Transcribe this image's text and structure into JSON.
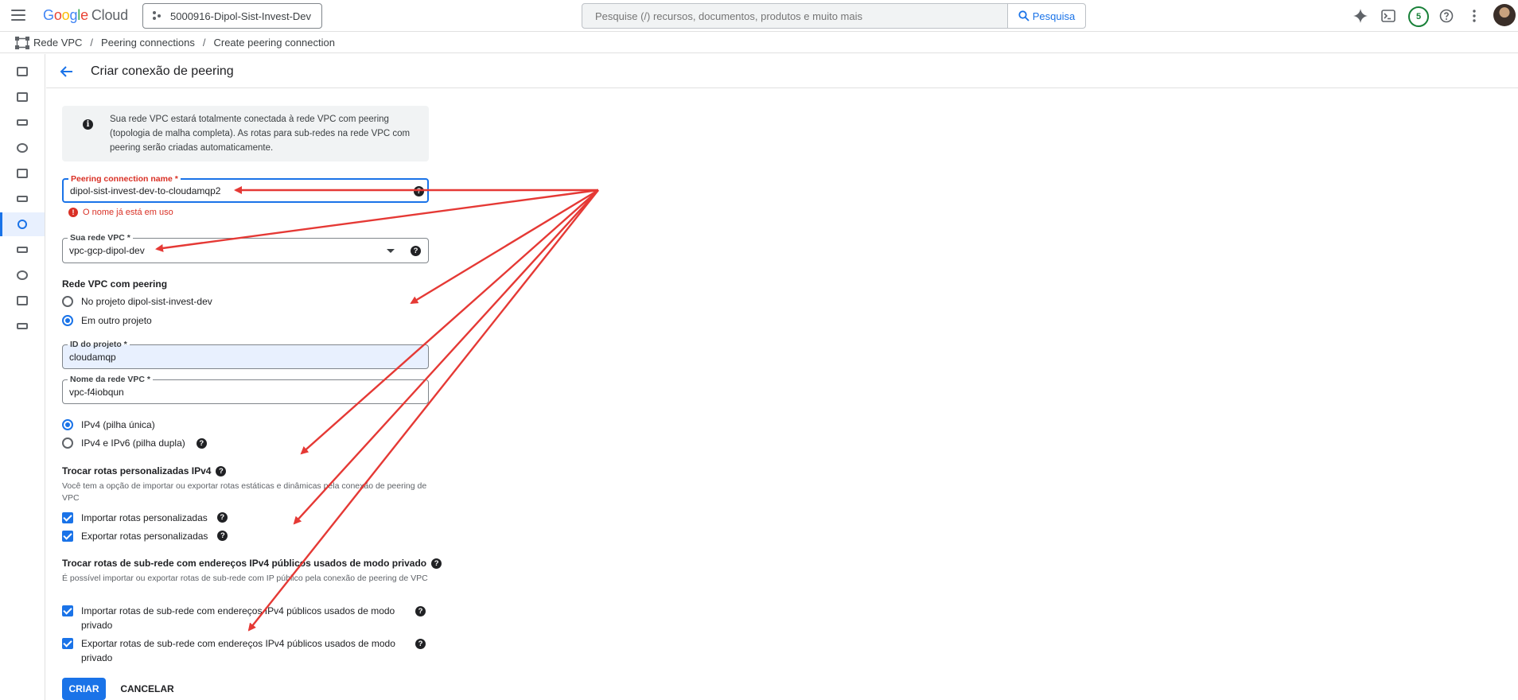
{
  "topbar": {
    "logo_google": "Google",
    "logo_cloud": "Cloud",
    "project": "5000916-Dipol-Sist-Invest-Dev",
    "search_placeholder": "Pesquise (/) recursos, documentos, produtos e muito mais",
    "search_button": "Pesquisa",
    "notifications_count": "5",
    "icons": [
      "menu-icon",
      "gemini-icon",
      "cloud-shell-icon",
      "help-icon",
      "more-vert-icon"
    ]
  },
  "breadcrumb": {
    "items": [
      "Rede VPC",
      "Peering connections",
      "Create peering connection"
    ],
    "separator": "/"
  },
  "page": {
    "title": "Criar conexão de peering"
  },
  "info": {
    "text": "Sua rede VPC estará totalmente conectada à rede VPC com peering (topologia de malha completa). As rotas para sub-redes na rede VPC com peering serão criadas automaticamente."
  },
  "form": {
    "name_label": "Peering connection name *",
    "name_value": "dipol-sist-invest-dev-to-cloudamqp2",
    "name_error": "O nome já está em uso",
    "vpc_label": "Sua rede VPC *",
    "vpc_value": "vpc-gcp-dipol-dev",
    "peered_title": "Rede VPC com peering",
    "peered_options": [
      "No projeto dipol-sist-invest-dev",
      "Em outro projeto"
    ],
    "peered_selected": "Em outro projeto",
    "project_id_label": "ID do projeto *",
    "project_id_value": "cloudamqp",
    "vpc_name_label": "Nome da rede VPC *",
    "vpc_name_value": "vpc-f4iobqun",
    "stack_options": [
      "IPv4 (pilha única)",
      "IPv4 e IPv6 (pilha dupla)"
    ],
    "stack_selected": "IPv4 (pilha única)",
    "custom_routes_title": "Trocar rotas personalizadas IPv4",
    "custom_routes_desc": "Você tem a opção de importar ou exportar rotas estáticas e dinâmicas pela conexão de peering de VPC",
    "import_custom": "Importar rotas personalizadas",
    "export_custom": "Exportar rotas personalizadas",
    "subnet_routes_title": "Trocar rotas de sub-rede com endereços IPv4 públicos usados de modo privado",
    "subnet_routes_desc": "É possível importar ou exportar rotas de sub-rede com IP público pela conexão de peering de VPC",
    "import_subnet": "Importar rotas de sub-rede com endereços IPv4 públicos usados de modo privado",
    "export_subnet": "Exportar rotas de sub-rede com endereços IPv4 públicos usados de modo privado",
    "create_button": "CRIAR",
    "cancel_button": "CANCELAR"
  },
  "colors": {
    "accent": "#1a73e8",
    "error": "#d93025",
    "annotation_arrow": "#e53935"
  }
}
